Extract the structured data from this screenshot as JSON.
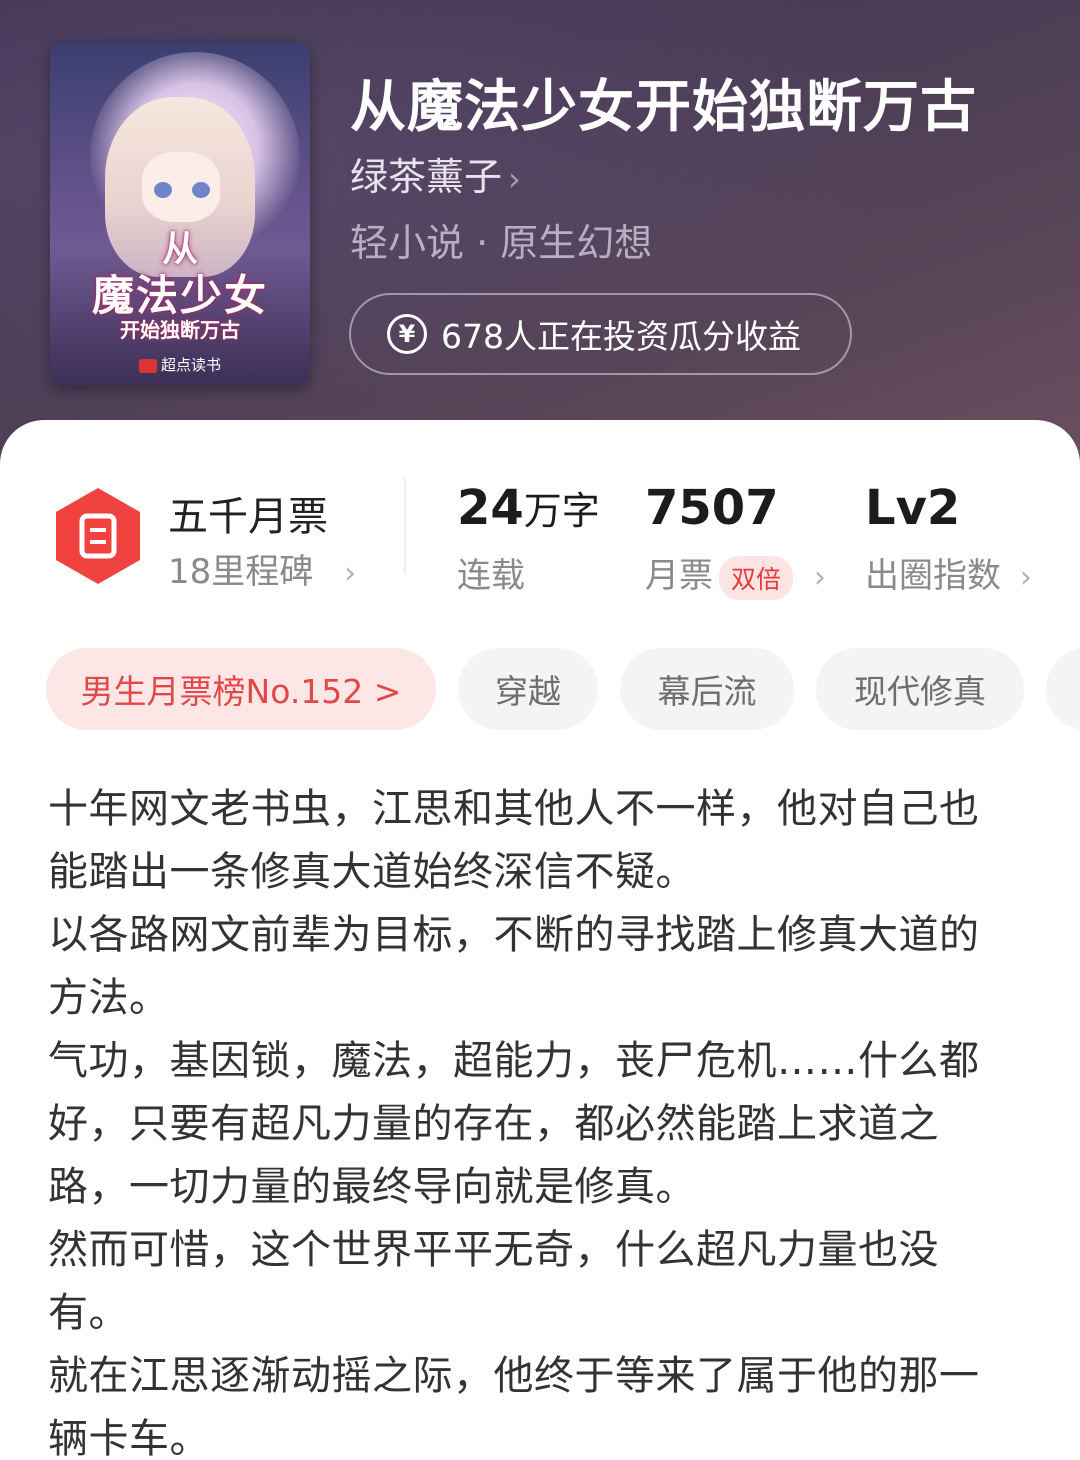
{
  "book": {
    "title": "从魔法少女开始独断万古",
    "author": "绿茶薰子",
    "category": "轻小说 · 原生幻想",
    "invest_label": "678人正在投资瓜分收益",
    "invest_icon": "yen-circle-icon"
  },
  "cover": {
    "title_line1": "从",
    "title_line2": "魔法少女",
    "title_line3": "开始独断万古",
    "publisher": "超点读书"
  },
  "stats": {
    "milestone_title": "五千月票",
    "milestone_sub": "18里程碑",
    "words_value": "24",
    "words_unit": "万字",
    "words_label": "连载",
    "tickets_value": "7507",
    "tickets_label": "月票",
    "tickets_badge": "双倍",
    "level_value": "Lv2",
    "level_label": "出圈指数",
    "badge_color": "#f0433f"
  },
  "tags": [
    {
      "label": "男生月票榜No.152 >"
    },
    {
      "label": "穿越"
    },
    {
      "label": "幕后流"
    },
    {
      "label": "现代修真"
    }
  ],
  "synopsis": [
    "十年网文老书虫，江思和其他人不一样，他对自己也能踏出一条修真大道始终深信不疑。",
    "以各路网文前辈为目标，不断的寻找踏上修真大道的方法。",
    "气功，基因锁，魔法，超能力，丧尸危机……什么都好，只要有超凡力量的存在，都必然能踏上求道之路，一切力量的最终导向就是修真。",
    "然而可惜，这个世界平平无奇，什么超凡力量也没有。",
    "就在江思逐渐动摇之际，他终于等来了属于他的那一辆卡车。"
  ]
}
